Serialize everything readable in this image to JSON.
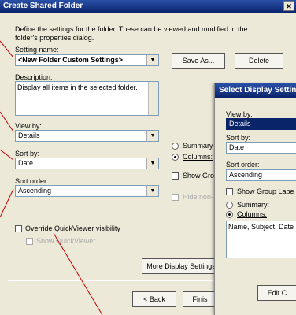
{
  "dialog": {
    "title": "Create Shared Folder",
    "close_glyph": "✕",
    "description": "Define the settings for the folder.  These can be viewed and modified in the folder's properties dialog.",
    "setting_name_label": "Setting name:",
    "setting_name_value": "<New Folder Custom Settings>",
    "save_as_label": "Save As...",
    "delete_label": "Delete",
    "description_label": "Description:",
    "description_value": "Display all items in the selected folder.",
    "view_by_label": "View by:",
    "view_by_value": "Details",
    "sort_by_label": "Sort by:",
    "sort_by_value": "Date",
    "sort_order_label": "Sort order:",
    "sort_order_value": "Ascending",
    "summary_label": "Summary",
    "columns_label": "Columns:",
    "show_groups_label": "Show Gro",
    "hide_label": "Hide non-",
    "override_label": "Override QuickViewer visibility",
    "show_quickviewer_label": "Show QuickViewer",
    "more_display_label": "More Display Settings",
    "back_label": "< Back",
    "finish_label": "Finis"
  },
  "panel": {
    "title": "Select Display Settin",
    "view_by_label": "View by:",
    "view_by_value": "Details",
    "sort_by_label": "Sort by:",
    "sort_by_value": "Date",
    "sort_order_label": "Sort order:",
    "sort_order_value": "Ascending",
    "show_group_label": "Show Group Labe",
    "summary_label": "Summary:",
    "columns_label": "Columns:",
    "columns_value": "Name, Subject, Date",
    "edit_label": "Edit C"
  },
  "icons": {
    "dropdown": "chevron-down-icon",
    "close": "close-icon"
  },
  "colors": {
    "title_bar": "#0a246a",
    "dialog_bg": "#ece9d8",
    "callout_line": "#c00000"
  }
}
